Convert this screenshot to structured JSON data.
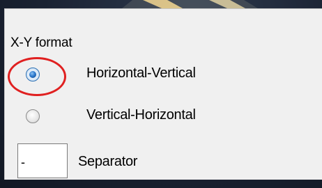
{
  "group": {
    "title": "X-Y format"
  },
  "options": [
    {
      "label": "Horizontal-Vertical",
      "selected": true
    },
    {
      "label": "Vertical-Horizontal",
      "selected": false
    }
  ],
  "separator": {
    "value": "-",
    "label": "Separator"
  },
  "colors": {
    "panel_background": "#f0f0f0",
    "backdrop": "#1b2433",
    "highlight_ring": "#e02020",
    "radio_selected": "#2e7bcf",
    "beam": "#f3d48a"
  }
}
